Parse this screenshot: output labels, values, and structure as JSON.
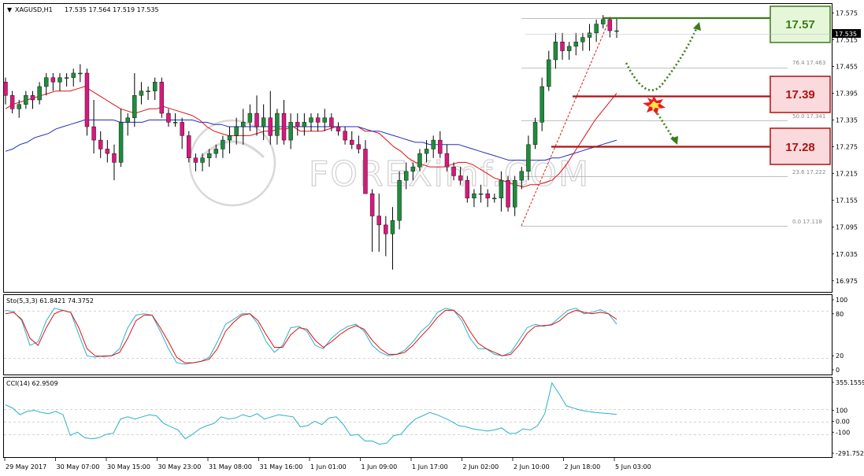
{
  "header": {
    "symbol": "XAGUSD,H1",
    "ohlc": "17.535 17.564 17.519 17.535",
    "current_price_label": "17.535"
  },
  "watermark": "FOREXimf.COM",
  "colors": {
    "bull": "#1e8c3c",
    "bear": "#d7187d",
    "ma_fast": "#e01010",
    "ma_slow": "#2030c0",
    "stoch_main": "#2ab0c8",
    "stoch_signal": "#e01010",
    "cci": "#2ab0c8",
    "resistance": "#3a7d18",
    "support": "#b11111"
  },
  "levels": [
    {
      "label": "17.57",
      "value": 17.57,
      "kind": "resistance"
    },
    {
      "label": "17.39",
      "value": 17.39,
      "kind": "support"
    },
    {
      "label": "17.28",
      "value": 17.28,
      "kind": "support"
    }
  ],
  "chart_data": [
    {
      "type": "candlestick",
      "title": "XAGUSD,H1",
      "ylim": [
        16.95,
        17.595
      ],
      "y_ticks": [
        "17.575",
        "17.515",
        "17.455",
        "17.395",
        "17.335",
        "17.275",
        "17.215",
        "17.155",
        "17.095",
        "17.035",
        "16.975"
      ],
      "x_ticks": [
        "29 May 2017",
        "30 May 07:00",
        "30 May 15:00",
        "30 May 23:00",
        "31 May 08:00",
        "31 May 16:00",
        "1 Jun 01:00",
        "1 Jun 09:00",
        "1 Jun 17:00",
        "2 Jun 02:00",
        "2 Jun 10:00",
        "2 Jun 18:00",
        "5 Jun 03:00"
      ],
      "candles": [
        [
          17.42,
          17.43,
          17.37,
          17.39
        ],
        [
          17.39,
          17.4,
          17.35,
          17.36
        ],
        [
          17.36,
          17.38,
          17.34,
          17.37
        ],
        [
          17.37,
          17.4,
          17.36,
          17.39
        ],
        [
          17.39,
          17.4,
          17.36,
          17.38
        ],
        [
          17.38,
          17.42,
          17.37,
          17.41
        ],
        [
          17.41,
          17.44,
          17.39,
          17.43
        ],
        [
          17.43,
          17.44,
          17.4,
          17.42
        ],
        [
          17.42,
          17.44,
          17.4,
          17.43
        ],
        [
          17.43,
          17.44,
          17.41,
          17.43
        ],
        [
          17.43,
          17.45,
          17.41,
          17.44
        ],
        [
          17.44,
          17.46,
          17.42,
          17.44
        ],
        [
          17.44,
          17.45,
          17.3,
          17.32
        ],
        [
          17.32,
          17.38,
          17.26,
          17.29
        ],
        [
          17.29,
          17.31,
          17.25,
          17.27
        ],
        [
          17.27,
          17.29,
          17.24,
          17.26
        ],
        [
          17.26,
          17.28,
          17.2,
          17.24
        ],
        [
          17.24,
          17.36,
          17.23,
          17.33
        ],
        [
          17.33,
          17.35,
          17.3,
          17.34
        ],
        [
          17.34,
          17.44,
          17.32,
          17.39
        ],
        [
          17.39,
          17.42,
          17.37,
          17.4
        ],
        [
          17.4,
          17.41,
          17.38,
          17.4
        ],
        [
          17.4,
          17.43,
          17.38,
          17.42
        ],
        [
          17.42,
          17.43,
          17.34,
          17.35
        ],
        [
          17.35,
          17.36,
          17.32,
          17.33
        ],
        [
          17.33,
          17.35,
          17.32,
          17.33
        ],
        [
          17.33,
          17.34,
          17.27,
          17.3
        ],
        [
          17.3,
          17.31,
          17.24,
          17.25
        ],
        [
          17.25,
          17.26,
          17.22,
          17.24
        ],
        [
          17.24,
          17.26,
          17.22,
          17.25
        ],
        [
          17.25,
          17.27,
          17.23,
          17.26
        ],
        [
          17.26,
          17.28,
          17.25,
          17.27
        ],
        [
          17.27,
          17.3,
          17.25,
          17.29
        ],
        [
          17.29,
          17.32,
          17.26,
          17.3
        ],
        [
          17.3,
          17.34,
          17.28,
          17.32
        ],
        [
          17.32,
          17.36,
          17.28,
          17.33
        ],
        [
          17.33,
          17.37,
          17.31,
          17.35
        ],
        [
          17.35,
          17.39,
          17.3,
          17.32
        ],
        [
          17.32,
          17.37,
          17.29,
          17.34
        ],
        [
          17.34,
          17.4,
          17.28,
          17.3
        ],
        [
          17.3,
          17.36,
          17.28,
          17.35
        ],
        [
          17.35,
          17.38,
          17.28,
          17.29
        ],
        [
          17.29,
          17.35,
          17.27,
          17.33
        ],
        [
          17.33,
          17.35,
          17.3,
          17.32
        ],
        [
          17.32,
          17.35,
          17.3,
          17.33
        ],
        [
          17.33,
          17.35,
          17.31,
          17.34
        ],
        [
          17.34,
          17.35,
          17.31,
          17.33
        ],
        [
          17.33,
          17.36,
          17.31,
          17.34
        ],
        [
          17.34,
          17.35,
          17.31,
          17.32
        ],
        [
          17.32,
          17.33,
          17.3,
          17.31
        ],
        [
          17.31,
          17.32,
          17.28,
          17.29
        ],
        [
          17.29,
          17.31,
          17.27,
          17.28
        ],
        [
          17.28,
          17.3,
          17.26,
          17.27
        ],
        [
          17.27,
          17.29,
          17.17,
          17.17
        ],
        [
          17.17,
          17.18,
          17.04,
          17.12
        ],
        [
          17.12,
          17.17,
          17.04,
          17.1
        ],
        [
          17.1,
          17.12,
          17.03,
          17.08
        ],
        [
          17.08,
          17.14,
          17.0,
          17.11
        ],
        [
          17.11,
          17.22,
          17.09,
          17.2
        ],
        [
          17.2,
          17.24,
          17.18,
          17.22
        ],
        [
          17.22,
          17.24,
          17.2,
          17.23
        ],
        [
          17.23,
          17.27,
          17.22,
          17.26
        ],
        [
          17.26,
          17.29,
          17.24,
          17.27
        ],
        [
          17.27,
          17.3,
          17.25,
          17.29
        ],
        [
          17.29,
          17.31,
          17.25,
          17.26
        ],
        [
          17.26,
          17.28,
          17.22,
          17.23
        ],
        [
          17.23,
          17.24,
          17.2,
          17.21
        ],
        [
          17.21,
          17.23,
          17.19,
          17.2
        ],
        [
          17.2,
          17.21,
          17.15,
          17.16
        ],
        [
          17.16,
          17.18,
          17.14,
          17.17
        ],
        [
          17.17,
          17.19,
          17.15,
          17.17
        ],
        [
          17.17,
          17.18,
          17.14,
          17.16
        ],
        [
          17.16,
          17.17,
          17.15,
          17.16
        ],
        [
          17.16,
          17.22,
          17.13,
          17.2
        ],
        [
          17.2,
          17.21,
          17.13,
          17.14
        ],
        [
          17.14,
          17.21,
          17.12,
          17.2
        ],
        [
          17.2,
          17.23,
          17.18,
          17.22
        ],
        [
          17.22,
          17.3,
          17.2,
          17.28
        ],
        [
          17.28,
          17.34,
          17.27,
          17.33
        ],
        [
          17.33,
          17.43,
          17.31,
          17.41
        ],
        [
          17.41,
          17.49,
          17.4,
          17.47
        ],
        [
          17.47,
          17.53,
          17.45,
          17.51
        ],
        [
          17.51,
          17.53,
          17.47,
          17.49
        ],
        [
          17.49,
          17.51,
          17.47,
          17.5
        ],
        [
          17.5,
          17.53,
          17.48,
          17.51
        ],
        [
          17.51,
          17.53,
          17.49,
          17.52
        ],
        [
          17.52,
          17.55,
          17.49,
          17.53
        ],
        [
          17.53,
          17.56,
          17.51,
          17.55
        ],
        [
          17.55,
          17.57,
          17.54,
          17.56
        ],
        [
          17.56,
          17.566,
          17.52,
          17.535
        ],
        [
          17.535,
          17.564,
          17.519,
          17.535
        ]
      ],
      "ma_fast": [
        17.36,
        17.37,
        17.375,
        17.38,
        17.385,
        17.39,
        17.395,
        17.4,
        17.4,
        17.4,
        17.405,
        17.41,
        17.4,
        17.39,
        17.38,
        17.37,
        17.36,
        17.355,
        17.35,
        17.355,
        17.36,
        17.36,
        17.365,
        17.36,
        17.355,
        17.35,
        17.345,
        17.335,
        17.32,
        17.31,
        17.305,
        17.3,
        17.3,
        17.3,
        17.3,
        17.305,
        17.31,
        17.31,
        17.315,
        17.315,
        17.32,
        17.31,
        17.31,
        17.31,
        17.31,
        17.315,
        17.32,
        17.32,
        17.32,
        17.32,
        17.31,
        17.31,
        17.305,
        17.29,
        17.275,
        17.265,
        17.25,
        17.24,
        17.235,
        17.23,
        17.23,
        17.23,
        17.235,
        17.24,
        17.24,
        17.235,
        17.225,
        17.215,
        17.205,
        17.2,
        17.195,
        17.19,
        17.185,
        17.19,
        17.19,
        17.195,
        17.2,
        17.215,
        17.235,
        17.26,
        17.285,
        17.31,
        17.335,
        17.355,
        17.375,
        17.395
      ],
      "ma_slow": [
        17.265,
        17.27,
        17.28,
        17.285,
        17.295,
        17.3,
        17.305,
        17.315,
        17.32,
        17.325,
        17.33,
        17.335,
        17.335,
        17.335,
        17.335,
        17.335,
        17.33,
        17.33,
        17.33,
        17.33,
        17.335,
        17.335,
        17.335,
        17.335,
        17.335,
        17.335,
        17.335,
        17.33,
        17.33,
        17.325,
        17.325,
        17.32,
        17.32,
        17.32,
        17.32,
        17.32,
        17.32,
        17.32,
        17.32,
        17.32,
        17.32,
        17.32,
        17.32,
        17.32,
        17.32,
        17.32,
        17.32,
        17.32,
        17.32,
        17.32,
        17.315,
        17.31,
        17.31,
        17.305,
        17.3,
        17.295,
        17.29,
        17.285,
        17.285,
        17.28,
        17.28,
        17.28,
        17.28,
        17.28,
        17.275,
        17.27,
        17.265,
        17.26,
        17.255,
        17.25,
        17.245,
        17.245,
        17.245,
        17.245,
        17.245,
        17.245,
        17.25,
        17.25,
        17.255,
        17.26,
        17.265,
        17.27,
        17.275,
        17.28,
        17.285,
        17.29
      ]
    },
    {
      "type": "line",
      "title": "Sto(5,3,3) 61.8421 74.3752",
      "ylim": [
        0,
        100
      ],
      "y_ticks": [
        "100",
        "80",
        "20",
        "0"
      ],
      "series": [
        {
          "name": "Sto main",
          "values": [
            85,
            83,
            70,
            35,
            40,
            70,
            88,
            85,
            82,
            50,
            20,
            18,
            20,
            20,
            30,
            60,
            78,
            80,
            78,
            55,
            30,
            10,
            8,
            10,
            12,
            18,
            40,
            65,
            72,
            80,
            80,
            65,
            40,
            25,
            35,
            60,
            62,
            55,
            35,
            30,
            45,
            55,
            62,
            65,
            55,
            35,
            25,
            20,
            22,
            28,
            40,
            55,
            65,
            82,
            88,
            85,
            70,
            45,
            30,
            30,
            22,
            20,
            25,
            42,
            60,
            65,
            62,
            65,
            75,
            85,
            88,
            80,
            82,
            86,
            80,
            65
          ]
        },
        {
          "name": "Sto signal",
          "values": [
            80,
            82,
            72,
            45,
            35,
            60,
            80,
            85,
            82,
            60,
            30,
            20,
            19,
            20,
            25,
            45,
            70,
            78,
            78,
            60,
            40,
            18,
            10,
            10,
            12,
            15,
            30,
            55,
            68,
            78,
            80,
            70,
            50,
            32,
            32,
            50,
            60,
            58,
            42,
            32,
            40,
            50,
            58,
            63,
            58,
            42,
            30,
            22,
            22,
            25,
            35,
            48,
            60,
            75,
            85,
            85,
            75,
            55,
            38,
            30,
            25,
            20,
            22,
            35,
            52,
            62,
            63,
            64,
            70,
            80,
            85,
            82,
            80,
            82,
            80,
            72
          ]
        }
      ]
    },
    {
      "type": "line",
      "title": "CCI(14) 62.9509",
      "ylim": [
        -291.7522,
        355.1559
      ],
      "y_ticks": [
        "355.1559",
        "100",
        "0.00",
        "-100",
        "-291.7522"
      ],
      "series": [
        {
          "name": "CCI",
          "values": [
            150,
            120,
            60,
            90,
            100,
            80,
            70,
            90,
            60,
            -130,
            -100,
            -150,
            -160,
            -150,
            -120,
            -110,
            20,
            40,
            20,
            40,
            60,
            50,
            -20,
            -50,
            -80,
            -160,
            -120,
            -70,
            -40,
            -20,
            40,
            20,
            30,
            60,
            40,
            70,
            20,
            40,
            60,
            50,
            40,
            -50,
            -40,
            0,
            -30,
            30,
            40,
            -30,
            -130,
            -120,
            -180,
            -180,
            -210,
            -200,
            -130,
            -120,
            -40,
            20,
            50,
            80,
            60,
            30,
            0,
            -40,
            -50,
            -70,
            -80,
            -90,
            -80,
            -60,
            -110,
            -110,
            -70,
            -80,
            -40,
            70,
            350,
            250,
            140,
            120,
            100,
            90,
            80,
            75,
            70,
            62.95
          ]
        }
      ]
    }
  ]
}
